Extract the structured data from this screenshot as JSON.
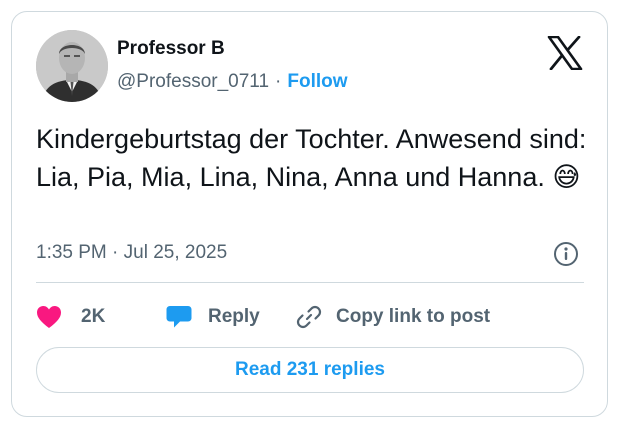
{
  "author": {
    "display_name": "Professor B",
    "handle": "@Professor_0711",
    "separator": "·",
    "follow_label": "Follow",
    "avatar_icon": "person-portrait"
  },
  "brand": {
    "logo_icon": "x-logo"
  },
  "tweet": {
    "text": "Kindergeburtstag der Tochter. Anwesend sind: Lia, Pia, Mia, Lina, Nina, Anna und Hanna. ",
    "emoji": "😅",
    "timestamp": "1:35 PM · Jul 25, 2025"
  },
  "actions": {
    "like_count": "2K",
    "reply_label": "Reply",
    "copy_label": "Copy link to post",
    "read_replies_label": "Read 231 replies"
  },
  "icons": {
    "like": "heart-icon",
    "reply": "speech-bubble-icon",
    "copy": "link-icon",
    "info": "info-icon"
  },
  "colors": {
    "accent": "#1d9bf0",
    "like": "#f91880",
    "text_primary": "#0f1419",
    "text_secondary": "#536471",
    "border": "#cfd9de"
  }
}
